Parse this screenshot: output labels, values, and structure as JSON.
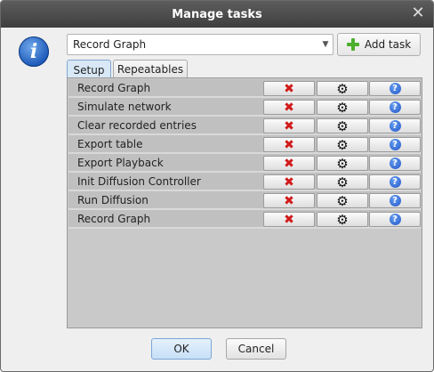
{
  "window": {
    "title": "Manage tasks",
    "close_glyph": "✕"
  },
  "header": {
    "info_glyph": "i",
    "task_select": {
      "value": "Record Graph"
    },
    "add_task_label": "Add task"
  },
  "tabs": [
    {
      "label": "Setup",
      "active": true
    },
    {
      "label": "Repeatables",
      "active": false
    }
  ],
  "tasks": [
    {
      "name": "Record Graph"
    },
    {
      "name": "Simulate network"
    },
    {
      "name": "Clear recorded entries"
    },
    {
      "name": "Export table"
    },
    {
      "name": "Export Playback"
    },
    {
      "name": "Init Diffusion Controller"
    },
    {
      "name": "Run Diffusion"
    },
    {
      "name": "Record Graph"
    }
  ],
  "row_actions": {
    "delete_glyph": "✖",
    "settings_glyph": "⚙",
    "help_glyph": "?"
  },
  "footer": {
    "ok_label": "OK",
    "cancel_label": "Cancel"
  },
  "colors": {
    "titlebar": "#4a4a4a",
    "row_bg": "#c0c0c0",
    "delete": "#d21a1a",
    "help": "#1f55c8",
    "add": "#4caf2e"
  }
}
